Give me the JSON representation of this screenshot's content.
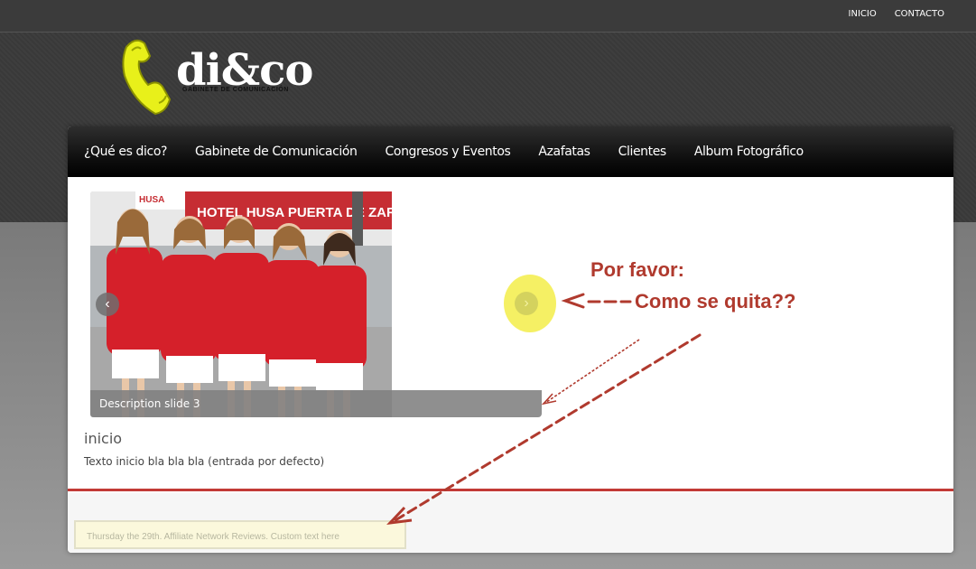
{
  "top_nav": {
    "items": [
      {
        "label": "INICIO"
      },
      {
        "label": "CONTACTO"
      }
    ]
  },
  "logo": {
    "text": "di&co",
    "subtitle": "GABINETE DE COMUNICACIÓN",
    "icon": "phone-handset-icon",
    "icon_color": "#e8f01a"
  },
  "main_nav": {
    "items": [
      {
        "label": "¿Qué es dico?"
      },
      {
        "label": "Gabinete de Comunicación"
      },
      {
        "label": "Congresos y Eventos"
      },
      {
        "label": "Azafatas"
      },
      {
        "label": "Clientes"
      },
      {
        "label": "Album Fotográfico"
      }
    ]
  },
  "slider": {
    "caption": "Description slide 3",
    "photo_sign": "HOTEL HUSA PUERTA DE ZARAGOZA",
    "photo_sign_small": "HUSA",
    "prev_icon": "chevron-left-icon",
    "next_icon": "chevron-right-icon"
  },
  "entry": {
    "title": "inicio",
    "text": "Texto inicio bla bla bla (entrada por defecto)"
  },
  "footer": {
    "custom_text": "Thursday the 29th. Affiliate Network Reviews. Custom text here"
  },
  "annotation": {
    "line1": "Por favor:",
    "line2": "Como se quita??",
    "color": "#b03a2e",
    "highlight_color": "#f5f064"
  },
  "colors": {
    "accent_red": "#c23a36",
    "nav_black": "#0c0c0c"
  }
}
